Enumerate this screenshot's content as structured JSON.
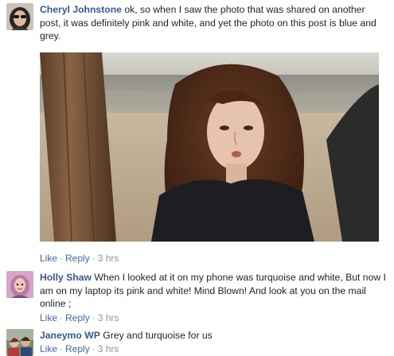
{
  "comments": [
    {
      "author": "Cheryl Johnstone",
      "text": "ok, so when I saw the photo that was shared on another post, it was definitely pink and white, and yet the photo on this post is blue and grey.",
      "like": "Like",
      "reply": "Reply",
      "separator": "·",
      "time": "3 hrs",
      "has_photo": true
    },
    {
      "author": "Holly Shaw",
      "text": "When I looked at it on my phone was turquoise and white, But now I am on my laptop its pink and white! Mind Blown! And look at you on the mail online ;",
      "like": "Like",
      "reply": "Reply",
      "separator": "·",
      "time": "3 hrs"
    },
    {
      "author": "Janeymo WP",
      "text": "Grey and turquoise for us",
      "like": "Like",
      "reply": "Reply",
      "separator": "·",
      "time": "3 hrs"
    }
  ],
  "colors": {
    "link_blue": "#365899",
    "action_blue": "#4267b2",
    "meta_grey": "#90949c",
    "text": "#1d2129"
  }
}
